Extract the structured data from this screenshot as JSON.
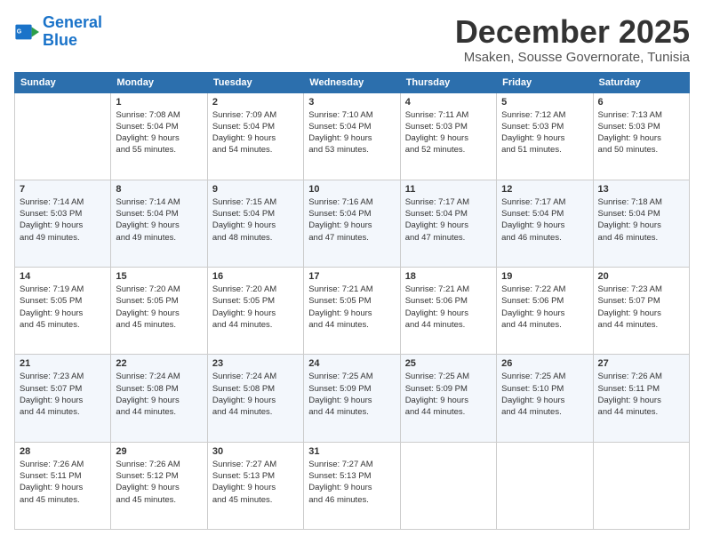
{
  "logo": {
    "line1": "General",
    "line2": "Blue"
  },
  "header": {
    "month": "December 2025",
    "location": "Msaken, Sousse Governorate, Tunisia"
  },
  "weekdays": [
    "Sunday",
    "Monday",
    "Tuesday",
    "Wednesday",
    "Thursday",
    "Friday",
    "Saturday"
  ],
  "weeks": [
    [
      {
        "date": "",
        "info": ""
      },
      {
        "date": "1",
        "info": "Sunrise: 7:08 AM\nSunset: 5:04 PM\nDaylight: 9 hours\nand 55 minutes."
      },
      {
        "date": "2",
        "info": "Sunrise: 7:09 AM\nSunset: 5:04 PM\nDaylight: 9 hours\nand 54 minutes."
      },
      {
        "date": "3",
        "info": "Sunrise: 7:10 AM\nSunset: 5:04 PM\nDaylight: 9 hours\nand 53 minutes."
      },
      {
        "date": "4",
        "info": "Sunrise: 7:11 AM\nSunset: 5:03 PM\nDaylight: 9 hours\nand 52 minutes."
      },
      {
        "date": "5",
        "info": "Sunrise: 7:12 AM\nSunset: 5:03 PM\nDaylight: 9 hours\nand 51 minutes."
      },
      {
        "date": "6",
        "info": "Sunrise: 7:13 AM\nSunset: 5:03 PM\nDaylight: 9 hours\nand 50 minutes."
      }
    ],
    [
      {
        "date": "7",
        "info": "Sunrise: 7:14 AM\nSunset: 5:03 PM\nDaylight: 9 hours\nand 49 minutes."
      },
      {
        "date": "8",
        "info": "Sunrise: 7:14 AM\nSunset: 5:04 PM\nDaylight: 9 hours\nand 49 minutes."
      },
      {
        "date": "9",
        "info": "Sunrise: 7:15 AM\nSunset: 5:04 PM\nDaylight: 9 hours\nand 48 minutes."
      },
      {
        "date": "10",
        "info": "Sunrise: 7:16 AM\nSunset: 5:04 PM\nDaylight: 9 hours\nand 47 minutes."
      },
      {
        "date": "11",
        "info": "Sunrise: 7:17 AM\nSunset: 5:04 PM\nDaylight: 9 hours\nand 47 minutes."
      },
      {
        "date": "12",
        "info": "Sunrise: 7:17 AM\nSunset: 5:04 PM\nDaylight: 9 hours\nand 46 minutes."
      },
      {
        "date": "13",
        "info": "Sunrise: 7:18 AM\nSunset: 5:04 PM\nDaylight: 9 hours\nand 46 minutes."
      }
    ],
    [
      {
        "date": "14",
        "info": "Sunrise: 7:19 AM\nSunset: 5:05 PM\nDaylight: 9 hours\nand 45 minutes."
      },
      {
        "date": "15",
        "info": "Sunrise: 7:20 AM\nSunset: 5:05 PM\nDaylight: 9 hours\nand 45 minutes."
      },
      {
        "date": "16",
        "info": "Sunrise: 7:20 AM\nSunset: 5:05 PM\nDaylight: 9 hours\nand 44 minutes."
      },
      {
        "date": "17",
        "info": "Sunrise: 7:21 AM\nSunset: 5:05 PM\nDaylight: 9 hours\nand 44 minutes."
      },
      {
        "date": "18",
        "info": "Sunrise: 7:21 AM\nSunset: 5:06 PM\nDaylight: 9 hours\nand 44 minutes."
      },
      {
        "date": "19",
        "info": "Sunrise: 7:22 AM\nSunset: 5:06 PM\nDaylight: 9 hours\nand 44 minutes."
      },
      {
        "date": "20",
        "info": "Sunrise: 7:23 AM\nSunset: 5:07 PM\nDaylight: 9 hours\nand 44 minutes."
      }
    ],
    [
      {
        "date": "21",
        "info": "Sunrise: 7:23 AM\nSunset: 5:07 PM\nDaylight: 9 hours\nand 44 minutes."
      },
      {
        "date": "22",
        "info": "Sunrise: 7:24 AM\nSunset: 5:08 PM\nDaylight: 9 hours\nand 44 minutes."
      },
      {
        "date": "23",
        "info": "Sunrise: 7:24 AM\nSunset: 5:08 PM\nDaylight: 9 hours\nand 44 minutes."
      },
      {
        "date": "24",
        "info": "Sunrise: 7:25 AM\nSunset: 5:09 PM\nDaylight: 9 hours\nand 44 minutes."
      },
      {
        "date": "25",
        "info": "Sunrise: 7:25 AM\nSunset: 5:09 PM\nDaylight: 9 hours\nand 44 minutes."
      },
      {
        "date": "26",
        "info": "Sunrise: 7:25 AM\nSunset: 5:10 PM\nDaylight: 9 hours\nand 44 minutes."
      },
      {
        "date": "27",
        "info": "Sunrise: 7:26 AM\nSunset: 5:11 PM\nDaylight: 9 hours\nand 44 minutes."
      }
    ],
    [
      {
        "date": "28",
        "info": "Sunrise: 7:26 AM\nSunset: 5:11 PM\nDaylight: 9 hours\nand 45 minutes."
      },
      {
        "date": "29",
        "info": "Sunrise: 7:26 AM\nSunset: 5:12 PM\nDaylight: 9 hours\nand 45 minutes."
      },
      {
        "date": "30",
        "info": "Sunrise: 7:27 AM\nSunset: 5:13 PM\nDaylight: 9 hours\nand 45 minutes."
      },
      {
        "date": "31",
        "info": "Sunrise: 7:27 AM\nSunset: 5:13 PM\nDaylight: 9 hours\nand 46 minutes."
      },
      {
        "date": "",
        "info": ""
      },
      {
        "date": "",
        "info": ""
      },
      {
        "date": "",
        "info": ""
      }
    ]
  ]
}
